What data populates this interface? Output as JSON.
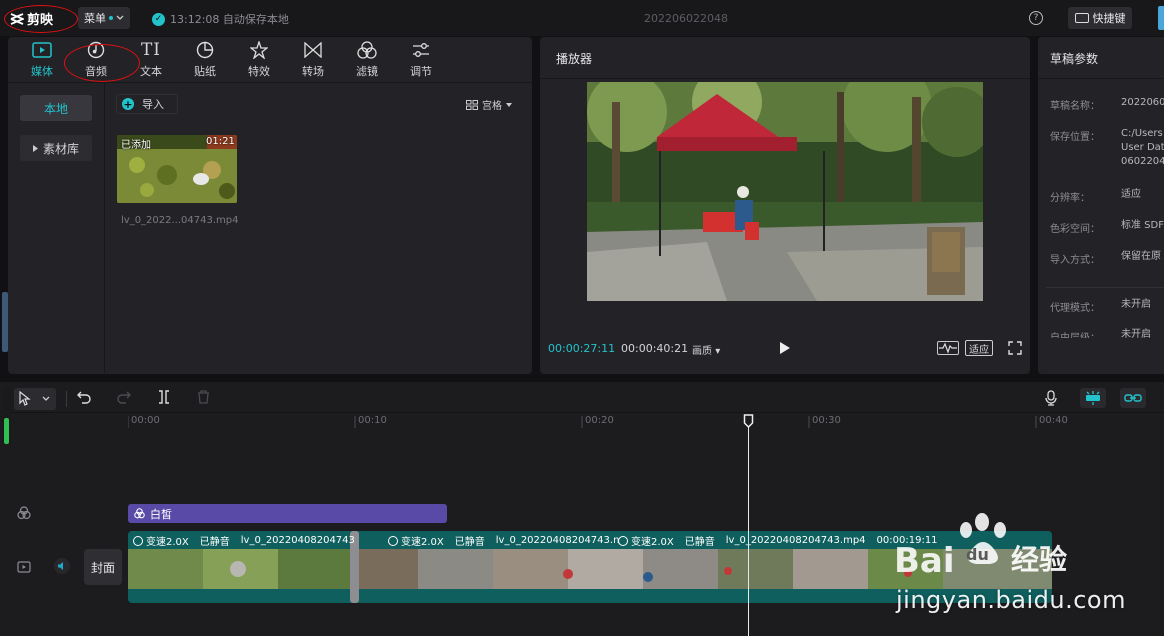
{
  "topbar": {
    "app_name": "剪映",
    "menu_label": "菜单",
    "autosave_text": "13:12:08 自动保存本地",
    "project_title": "202206022048",
    "shortcut_label": "快捷键",
    "help_glyph": "?"
  },
  "media_toolbar": {
    "tools": [
      {
        "label": "媒体",
        "icon": "media-icon",
        "active": true
      },
      {
        "label": "音频",
        "icon": "audio-icon",
        "active": false
      },
      {
        "label": "文本",
        "icon": "text-icon",
        "active": false
      },
      {
        "label": "贴纸",
        "icon": "sticker-icon",
        "active": false
      },
      {
        "label": "特效",
        "icon": "effects-icon",
        "active": false
      },
      {
        "label": "转场",
        "icon": "transition-icon",
        "active": false
      },
      {
        "label": "滤镜",
        "icon": "filter-icon",
        "active": false
      },
      {
        "label": "调节",
        "icon": "adjust-icon",
        "active": false
      }
    ],
    "text_glyph": "TI"
  },
  "media": {
    "nav": {
      "local": "本地",
      "library": "素材库"
    },
    "import_label": "导入",
    "view_label": "宫格",
    "item": {
      "added_badge": "已添加",
      "duration": "01:21",
      "filename": "lv_0_2022...04743.mp4"
    }
  },
  "player": {
    "title": "播放器",
    "current_time": "00:00:27:11",
    "total_time": "00:00:40:21",
    "quality_label": "画质",
    "fit_label": "适应"
  },
  "params": {
    "title": "草稿参数",
    "rows": [
      {
        "label": "草稿名称：",
        "value": [
          "2022060"
        ]
      },
      {
        "label": "保存位置：",
        "value": [
          "C:/Users",
          "User Dat",
          "0602204"
        ]
      },
      {
        "label": "分辨率：",
        "value": [
          "适应"
        ]
      },
      {
        "label": "色彩空间：",
        "value": [
          "标准 SDF"
        ]
      },
      {
        "label": "导入方式：",
        "value": [
          "保留在原"
        ]
      },
      {
        "label": "代理模式：",
        "value": [
          "未开启"
        ]
      },
      {
        "label": "自由层级：",
        "value": [
          "未开启"
        ]
      }
    ]
  },
  "timeline": {
    "ticks": [
      "00:00",
      "00:10",
      "00:20",
      "00:30",
      "00:40"
    ],
    "text_clip_label": "白皙",
    "cover_label": "封面",
    "clip_labels": [
      {
        "speed": "变速2.0X",
        "mute": "已静音",
        "name": "lv_0_20220408204743"
      },
      {
        "speed": "变速2.0X",
        "mute": "已静音",
        "name": "lv_0_20220408204743.n"
      },
      {
        "speed": "变速2.0X",
        "mute": "已静音",
        "name": "lv_0_20220408204743.mp4",
        "duration": "00:00:19:11"
      }
    ]
  },
  "watermark": {
    "brand_word": "经验",
    "url": "jingyan.baidu.com"
  },
  "colors": {
    "accent": "#22c3cc",
    "annotation_red": "#dd1111",
    "text_clip": "#5a4aa8",
    "video_track": "#0f5f5f"
  }
}
